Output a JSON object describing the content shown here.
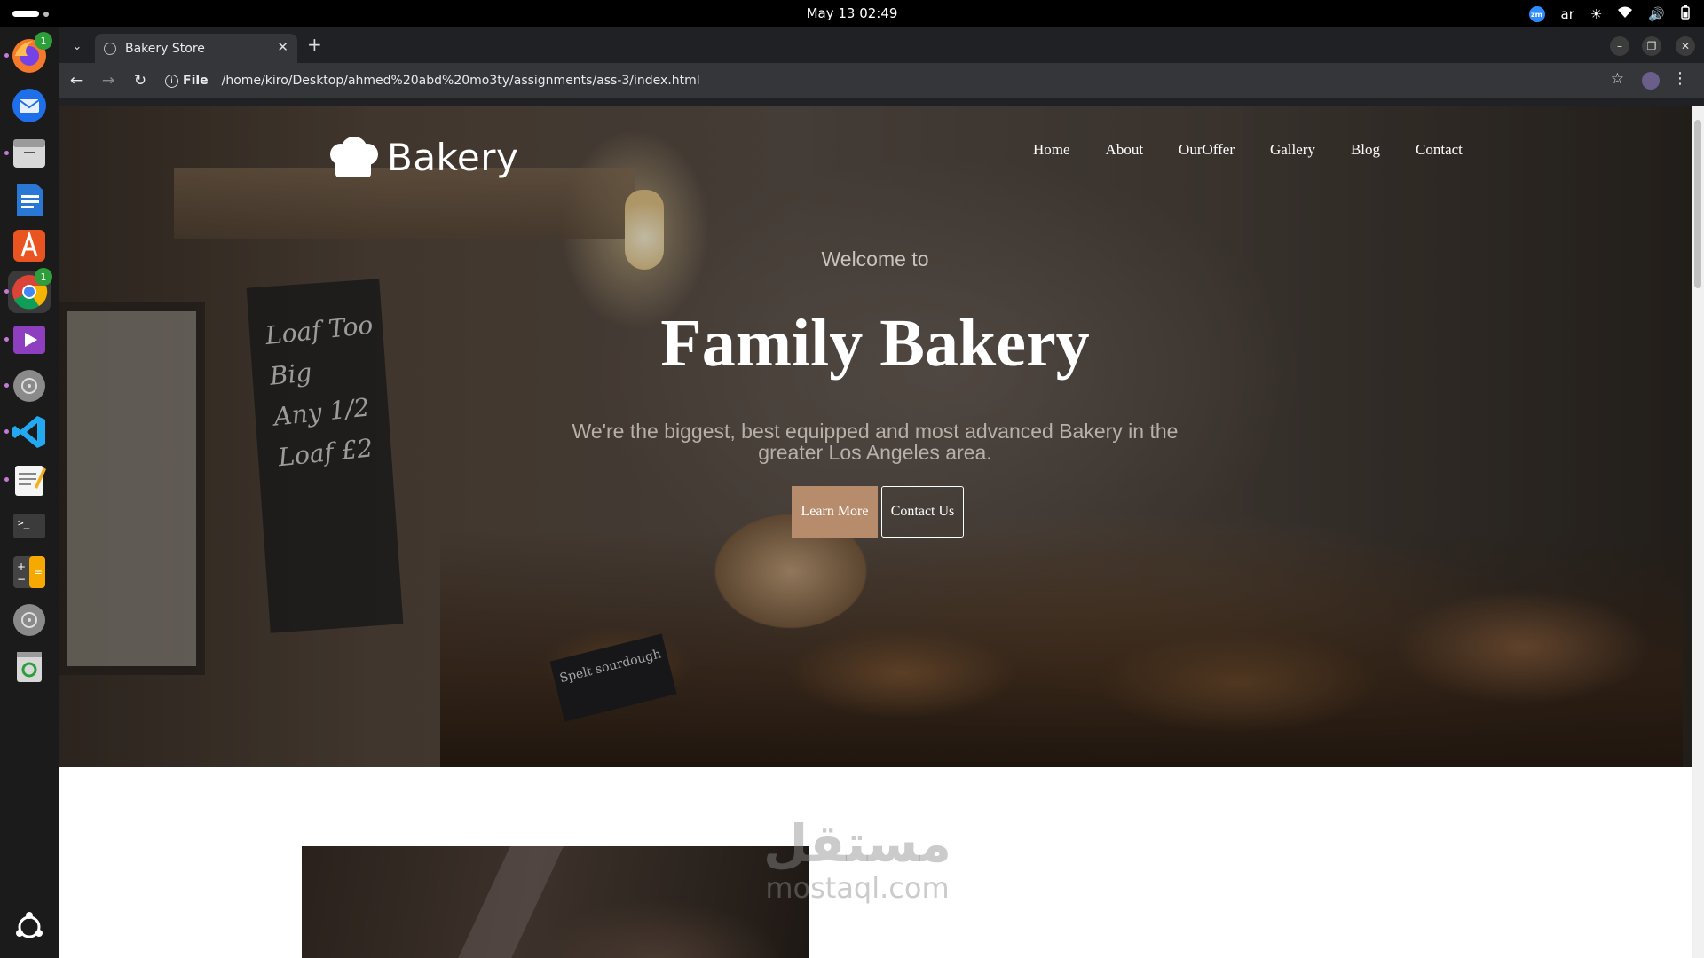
{
  "topbar": {
    "clock": "May 13  02:49",
    "keyboard_layout": "ar",
    "zoom_badge": "zm"
  },
  "dock": {
    "items": [
      {
        "name": "firefox",
        "badge": "1"
      },
      {
        "name": "thunderbird"
      },
      {
        "name": "files"
      },
      {
        "name": "writer"
      },
      {
        "name": "app-center"
      },
      {
        "name": "chrome",
        "badge": "1"
      },
      {
        "name": "media-player"
      },
      {
        "name": "disk"
      },
      {
        "name": "vscode"
      },
      {
        "name": "text-editor"
      },
      {
        "name": "terminal"
      },
      {
        "name": "calculator"
      },
      {
        "name": "disk-2"
      },
      {
        "name": "trash"
      }
    ]
  },
  "browser": {
    "tab_title": "Bakery Store",
    "new_tab": "+",
    "url_scheme": "File",
    "url": "/home/kiro/Desktop/ahmed%20abd%20mo3ty/assignments/ass-3/index.html"
  },
  "site": {
    "logo": "Bakery",
    "nav": [
      "Home",
      "About",
      "OurOffer",
      "Gallery",
      "Blog",
      "Contact"
    ],
    "hero": {
      "welcome": "Welcome to",
      "headline": "Family Bakery",
      "tagline": "We're the biggest, best equipped and most advanced Bakery in the greater Los Angeles area.",
      "learn_more": "Learn More",
      "contact_us": "Contact Us"
    },
    "chalkboard_lines": [
      "Loaf Too",
      "Big",
      "Any 1/2",
      "Loaf £2"
    ],
    "bread_tag": "Spelt sourdough"
  },
  "watermark": {
    "arabic": "مستقل",
    "latin": "mostaql.com"
  },
  "colors": {
    "accent_button": "#b78c6c",
    "page_bg": "#ffffff",
    "chrome_dark": "#202124"
  }
}
